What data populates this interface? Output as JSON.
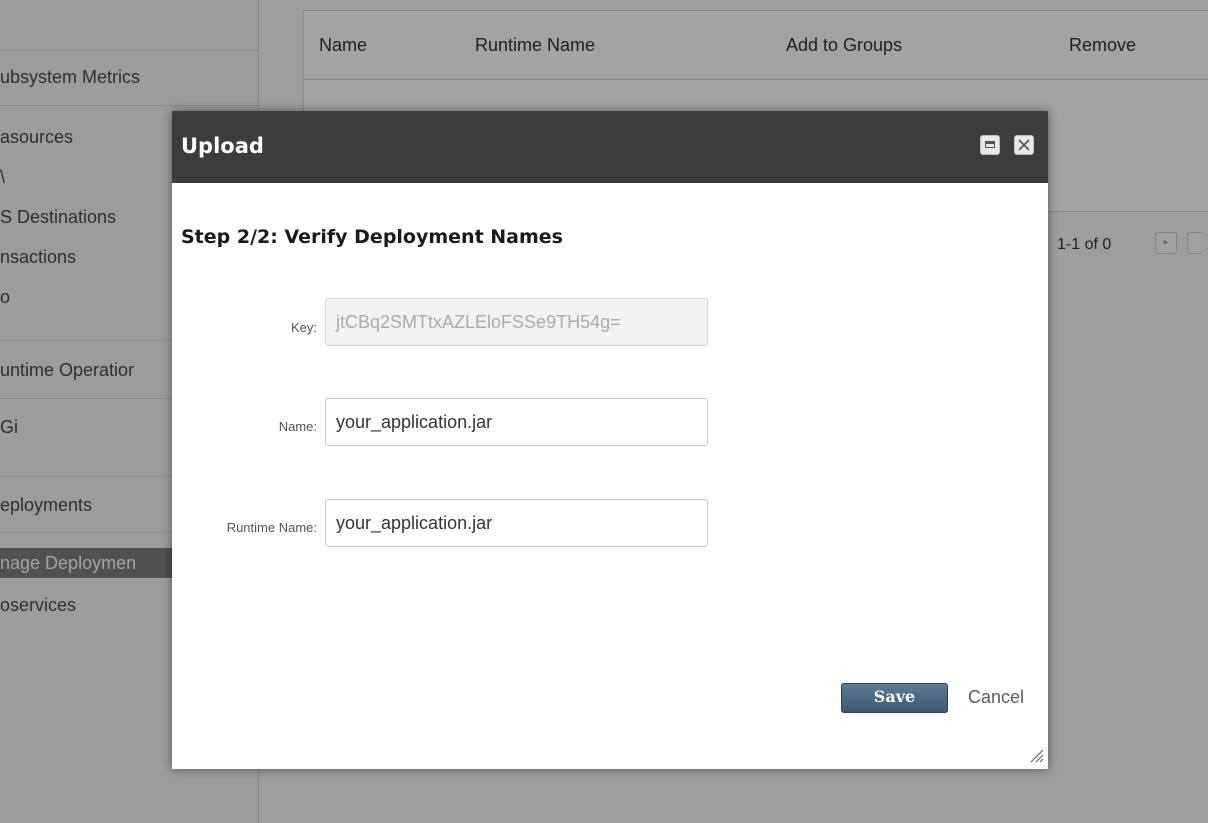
{
  "sidebar": {
    "items": [
      {
        "label": "ubsystem Metrics"
      },
      {
        "label": "asources"
      },
      {
        "label": "\\"
      },
      {
        "label": "S Destinations"
      },
      {
        "label": "nsactions"
      },
      {
        "label": "o"
      },
      {
        "label": "untime Operatior"
      },
      {
        "label": "Gi"
      },
      {
        "label": "eployments"
      },
      {
        "label": "nage Deploymen"
      },
      {
        "label": "oservices"
      }
    ]
  },
  "grid": {
    "columns": [
      "Name",
      "Runtime Name",
      "Add to Groups",
      "Remove"
    ],
    "pager_text": "1-1 of 0",
    "next_icon": "next-page-icon",
    "last_icon": "last-page-icon"
  },
  "dialog": {
    "title": "Upload",
    "minimize_icon": "minimize-icon",
    "close_icon": "close-icon",
    "step_title": "Step 2/2: Verify Deployment Names",
    "fields": {
      "key": {
        "label": "Key:",
        "value": "jtCBq2SMTtxAZLEloFSSe9TH54g="
      },
      "name": {
        "label": "Name:",
        "value": "your_application.jar"
      },
      "runtime_name": {
        "label": "Runtime Name:",
        "value": "your_application.jar"
      }
    },
    "save_label": "Save",
    "cancel_label": "Cancel",
    "resize_icon": "resize-grip-icon"
  },
  "colors": {
    "header_bg": "#3c3c3c",
    "save_button": "#4a667f",
    "selected_nav": "#7f7f7f"
  }
}
